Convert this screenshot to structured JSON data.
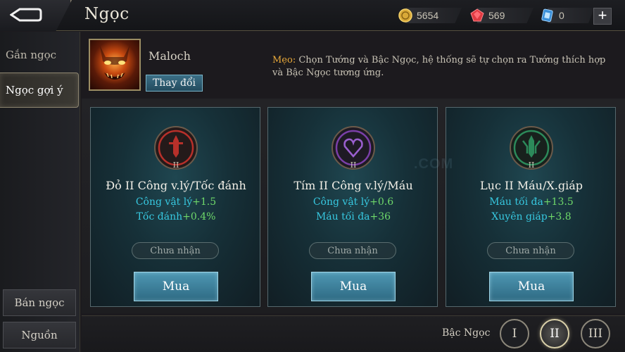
{
  "header": {
    "title": "Ngọc",
    "currencies": [
      {
        "icon": "gold-coin-icon",
        "value": "5654"
      },
      {
        "icon": "ruby-gem-icon",
        "value": "569"
      },
      {
        "icon": "voucher-card-icon",
        "value": "0"
      }
    ],
    "plus_label": "+"
  },
  "sidebar": {
    "tabs": [
      {
        "label": "Gắn ngọc",
        "active": false
      },
      {
        "label": "Ngọc gợi ý",
        "active": true
      }
    ],
    "buttons": [
      {
        "label": "Bán ngọc"
      },
      {
        "label": "Nguồn"
      }
    ]
  },
  "hero": {
    "name": "Maloch",
    "change_label": "Thay đổi"
  },
  "tip": {
    "label": "Mẹo:",
    "text": " Chọn Tướng và Bậc Ngọc, hệ thống sẽ tự chọn ra Tướng thích hợp và Bậc Ngọc tương ứng."
  },
  "cards": [
    {
      "color": "#b8302a",
      "tier": "II",
      "title": "Đỏ II Công v.lý/Tốc đánh",
      "stats": [
        {
          "name": "Công vật lý",
          "value": "+1.5"
        },
        {
          "name": "Tốc đánh",
          "value": "+0.4%"
        }
      ],
      "status": "Chưa nhận",
      "buy_label": "Mua"
    },
    {
      "color": "#7a3fa8",
      "tier": "II",
      "title": "Tím II Công v.lý/Máu",
      "stats": [
        {
          "name": "Công vật lý",
          "value": "+0.6"
        },
        {
          "name": "Máu tối đa",
          "value": "+36"
        }
      ],
      "status": "Chưa nhận",
      "buy_label": "Mua"
    },
    {
      "color": "#2c8a5a",
      "tier": "II",
      "title": "Lục II Máu/X.giáp",
      "stats": [
        {
          "name": "Máu tối đa",
          "value": "+13.5"
        },
        {
          "name": "Xuyên giáp",
          "value": "+3.8"
        }
      ],
      "status": "Chưa nhận",
      "buy_label": "Mua"
    }
  ],
  "tier_selector": {
    "label": "Bậc Ngọc",
    "tiers": [
      "I",
      "II",
      "III"
    ],
    "selected": "II"
  },
  "watermark": ".COM"
}
